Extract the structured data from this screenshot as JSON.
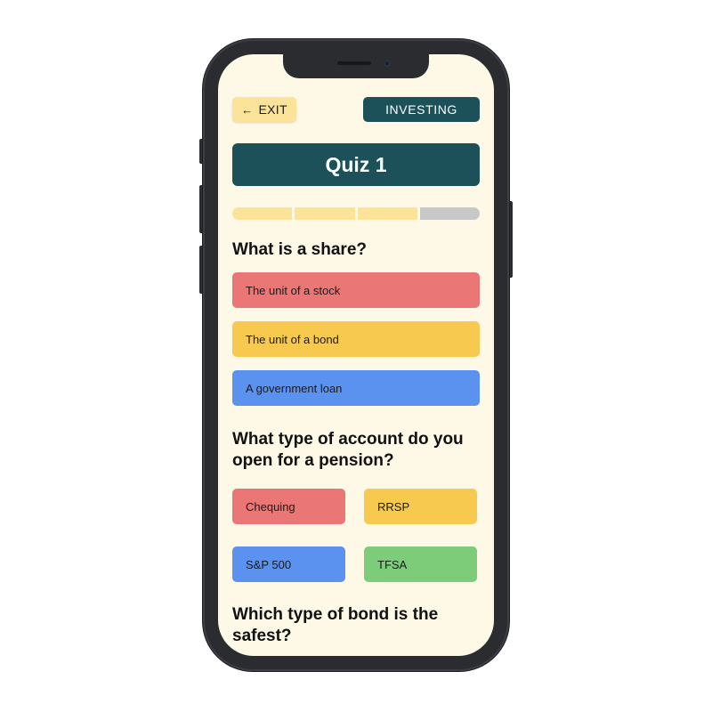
{
  "header": {
    "exit_label": "EXIT",
    "category_label": "INVESTING"
  },
  "quiz": {
    "title": "Quiz 1",
    "progress": {
      "completed_segments": 3,
      "total_segments": 4,
      "segment_colors": [
        "#fce39a",
        "#fce39a",
        "#fce39a",
        "#c8c8c8"
      ]
    }
  },
  "questions": [
    {
      "text": "What is a share?",
      "answers": [
        {
          "label": "The unit of a stock",
          "color": "#ea7676"
        },
        {
          "label": "The unit of a bond",
          "color": "#f7c94f"
        },
        {
          "label": "A government loan",
          "color": "#5b92ef"
        }
      ]
    },
    {
      "text": "What type of account do you open for a pension?",
      "answers": [
        {
          "label": "Chequing",
          "color": "#ea7676"
        },
        {
          "label": "RRSP",
          "color": "#f7c94f"
        },
        {
          "label": "S&P 500",
          "color": "#5b92ef"
        },
        {
          "label": "TFSA",
          "color": "#7ccc7a"
        }
      ]
    },
    {
      "text": "Which type of bond is the safest?"
    }
  ],
  "colors": {
    "screen_background": "#fef8e6",
    "primary_dark": "#1d5159",
    "exit_button": "#fce39a",
    "phone_frame": "#2a2c30"
  },
  "icons": {
    "exit": "arrow-left-icon"
  }
}
